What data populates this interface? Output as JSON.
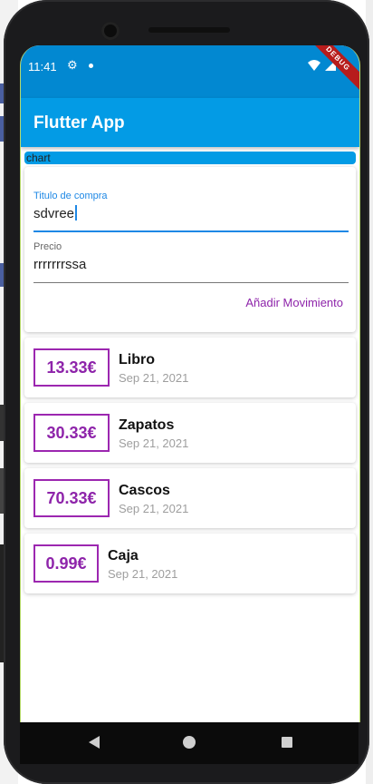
{
  "status_bar": {
    "time": "11:41"
  },
  "debug_banner": "DEBUG",
  "app_bar": {
    "title": "Flutter App"
  },
  "chart": {
    "label": "chart"
  },
  "form": {
    "title_field": {
      "label": "Titulo de compra",
      "value": "sdvree"
    },
    "price_field": {
      "label": "Precio",
      "value": "rrrrrrrssa"
    },
    "add_button": "Añadir Movimiento"
  },
  "transactions": [
    {
      "amount": "13.33€",
      "title": "Libro",
      "date": "Sep 21, 2021"
    },
    {
      "amount": "30.33€",
      "title": "Zapatos",
      "date": "Sep 21, 2021"
    },
    {
      "amount": "70.33€",
      "title": "Cascos",
      "date": "Sep 21, 2021"
    },
    {
      "amount": "0.99€",
      "title": "Caja",
      "date": "Sep 21, 2021"
    }
  ],
  "colors": {
    "primary": "#039be5",
    "status_bar": "#0288d1",
    "accent": "#8e24aa",
    "focus": "#1e88e5"
  }
}
